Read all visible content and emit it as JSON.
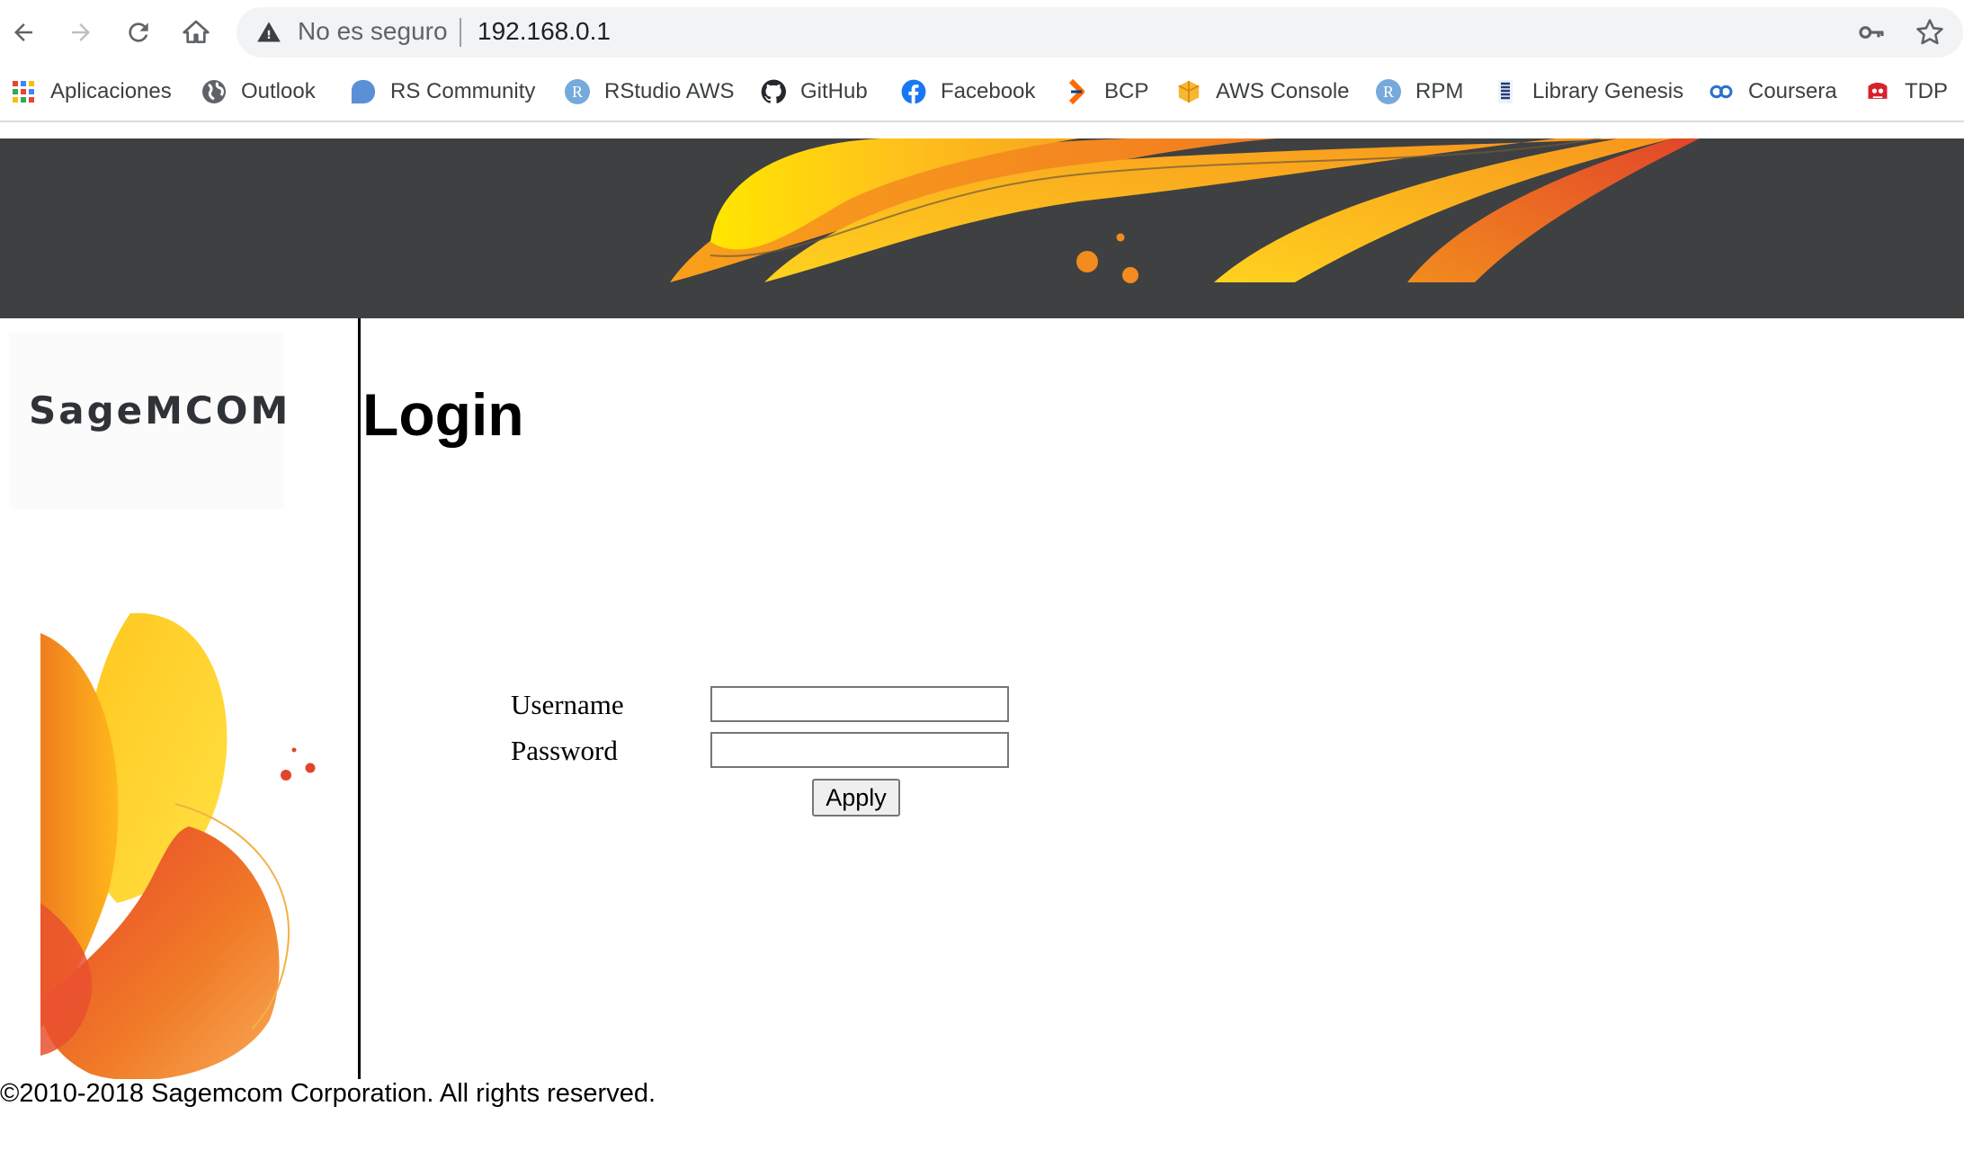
{
  "browser": {
    "security_label": "No es seguro",
    "url": "192.168.0.1",
    "bookmarks": [
      {
        "label": "Aplicaciones",
        "icon": "apps-grid-icon"
      },
      {
        "label": "Outlook",
        "icon": "globe-icon"
      },
      {
        "label": "RS Community",
        "icon": "rs-community-icon"
      },
      {
        "label": "RStudio AWS",
        "icon": "rstudio-icon"
      },
      {
        "label": "GitHub",
        "icon": "github-icon"
      },
      {
        "label": "Facebook",
        "icon": "facebook-icon"
      },
      {
        "label": "BCP",
        "icon": "bcp-icon"
      },
      {
        "label": "AWS Console",
        "icon": "aws-icon"
      },
      {
        "label": "RPM",
        "icon": "rpm-icon"
      },
      {
        "label": "Library Genesis",
        "icon": "library-genesis-icon"
      },
      {
        "label": "Coursera",
        "icon": "coursera-icon"
      },
      {
        "label": "TDP",
        "icon": "tdp-icon"
      }
    ],
    "rstudio_glyph": "R",
    "rpm_glyph": "R"
  },
  "page": {
    "logo_text": "SageMCOM",
    "title": "Login",
    "username_label": "Username",
    "password_label": "Password",
    "username_value": "",
    "password_value": "",
    "apply_label": "Apply",
    "copyright": "©2010-2018 Sagemcom Corporation. All rights reserved."
  },
  "colors": {
    "banner": "#3f4042",
    "accent_orange": "#f28c1e",
    "accent_yellow": "#ffd21f",
    "accent_red": "#e2452a"
  }
}
